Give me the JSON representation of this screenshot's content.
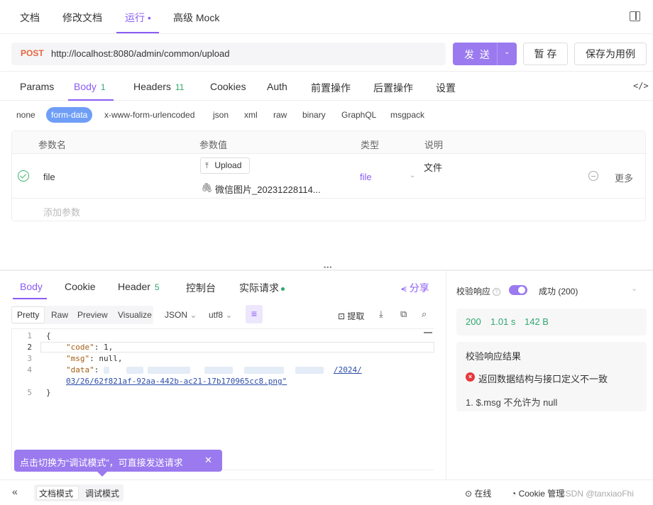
{
  "top_tabs": [
    {
      "label": "文档"
    },
    {
      "label": "修改文档"
    },
    {
      "label": "运行 •"
    },
    {
      "label": "高级 Mock"
    }
  ],
  "request": {
    "method": "POST",
    "url": "http://localhost:8080/admin/common/upload",
    "send_label": "发 送",
    "pause_label": "暂 存",
    "save_case_label": "保存为用例"
  },
  "request_tabs": [
    {
      "label": "Params",
      "count": ""
    },
    {
      "label": "Body",
      "count": "1"
    },
    {
      "label": "Headers",
      "count": "11"
    },
    {
      "label": "Cookies",
      "count": ""
    },
    {
      "label": "Auth",
      "count": ""
    },
    {
      "label": "前置操作",
      "count": ""
    },
    {
      "label": "后置操作",
      "count": ""
    },
    {
      "label": "设置",
      "count": ""
    }
  ],
  "body_types": [
    "none",
    "form-data",
    "x-www-form-urlencoded",
    "json",
    "xml",
    "raw",
    "binary",
    "GraphQL",
    "msgpack"
  ],
  "params_table": {
    "headers": [
      "参数名",
      "参数值",
      "类型",
      "说明"
    ],
    "row": {
      "name": "file",
      "upload_label": "Upload",
      "filename": "微信图片_20231228114...",
      "type": "file",
      "description": "文件",
      "more": "更多"
    },
    "add_param": "添加参数"
  },
  "response_tabs": [
    {
      "label": "Body",
      "count": ""
    },
    {
      "label": "Cookie",
      "count": ""
    },
    {
      "label": "Header",
      "count": "5"
    },
    {
      "label": "控制台",
      "count": ""
    },
    {
      "label": "实际请求",
      "count": ""
    }
  ],
  "share_label": "分享",
  "formats": [
    "Pretty",
    "Raw",
    "Preview",
    "Visualize"
  ],
  "format_select": "JSON",
  "encoding_select": "utf8",
  "extract_label": "提取",
  "code": {
    "line_numbers": [
      "1",
      "2",
      "3",
      "4",
      "",
      "5"
    ],
    "open": "{",
    "code_key": "\"code\"",
    "code_val": " 1,",
    "msg_key": "\"msg\"",
    "msg_val": " null,",
    "data_key": "\"data\"",
    "data_tail": "/2024/",
    "data_cont": "03/26/62f821af-92aa-442b-ac21-17b170965cc8.png\"",
    "close": "}"
  },
  "verify": {
    "label": "校验响应",
    "status": "成功 (200)",
    "status_code": "200",
    "time": "1.01 s",
    "size": "142 B",
    "result_title": "校验响应结果",
    "error": "返回数据结构与接口定义不一致",
    "detail": "1. $.msg 不允许为 null"
  },
  "tooltip": "点击切换为“调试模式”，可直接发送请求",
  "bottom": {
    "doc_mode": "文档模式",
    "debug_mode": "调试模式",
    "online": "在线",
    "cookie_mgmt": "Cookie 管理",
    "watermark": "CSDN @tanxiaoFhi"
  },
  "colors": {
    "accent": "#8b5cf6",
    "method_post": "#e8663d",
    "success": "#2fa86f",
    "error": "#e5383b"
  }
}
